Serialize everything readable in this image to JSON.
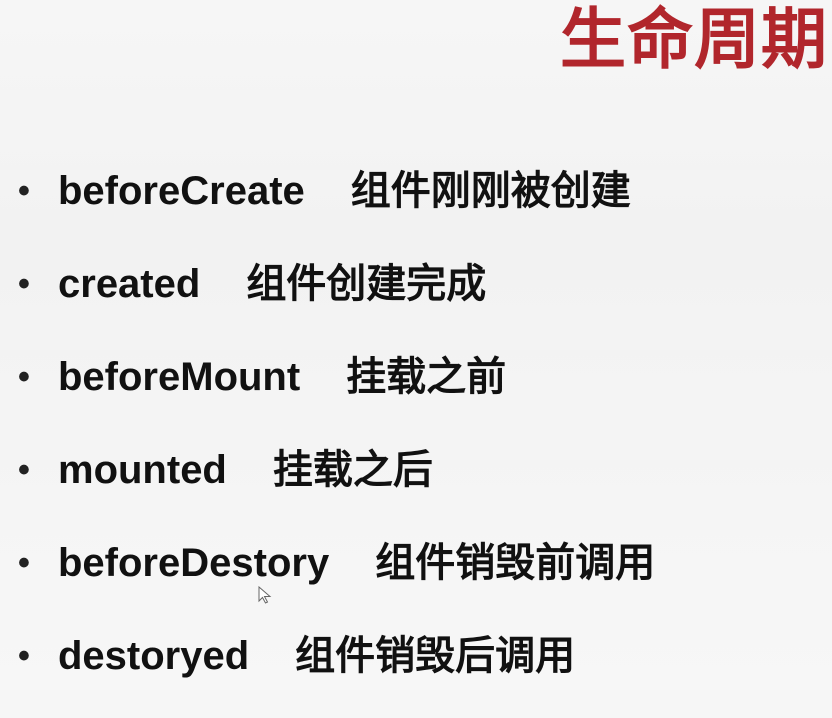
{
  "title": "生命周期",
  "items": [
    {
      "bullet": "•",
      "hook": "beforeCreate",
      "desc": "组件刚刚被创建"
    },
    {
      "bullet": "•",
      "hook": "created",
      "desc": "组件创建完成"
    },
    {
      "bullet": "•",
      "hook": "beforeMount",
      "desc": "挂载之前"
    },
    {
      "bullet": "•",
      "hook": "mounted",
      "desc": "挂载之后"
    },
    {
      "bullet": "•",
      "hook": "beforeDestory",
      "desc": "组件销毁前调用"
    },
    {
      "bullet": "•",
      "hook": "destoryed",
      "desc": "组件销毁后调用"
    }
  ],
  "colors": {
    "title": "#b1262c",
    "text": "#111111",
    "background": "#f4f4f4"
  },
  "icons": {
    "cursor": "mouse-pointer-icon"
  }
}
